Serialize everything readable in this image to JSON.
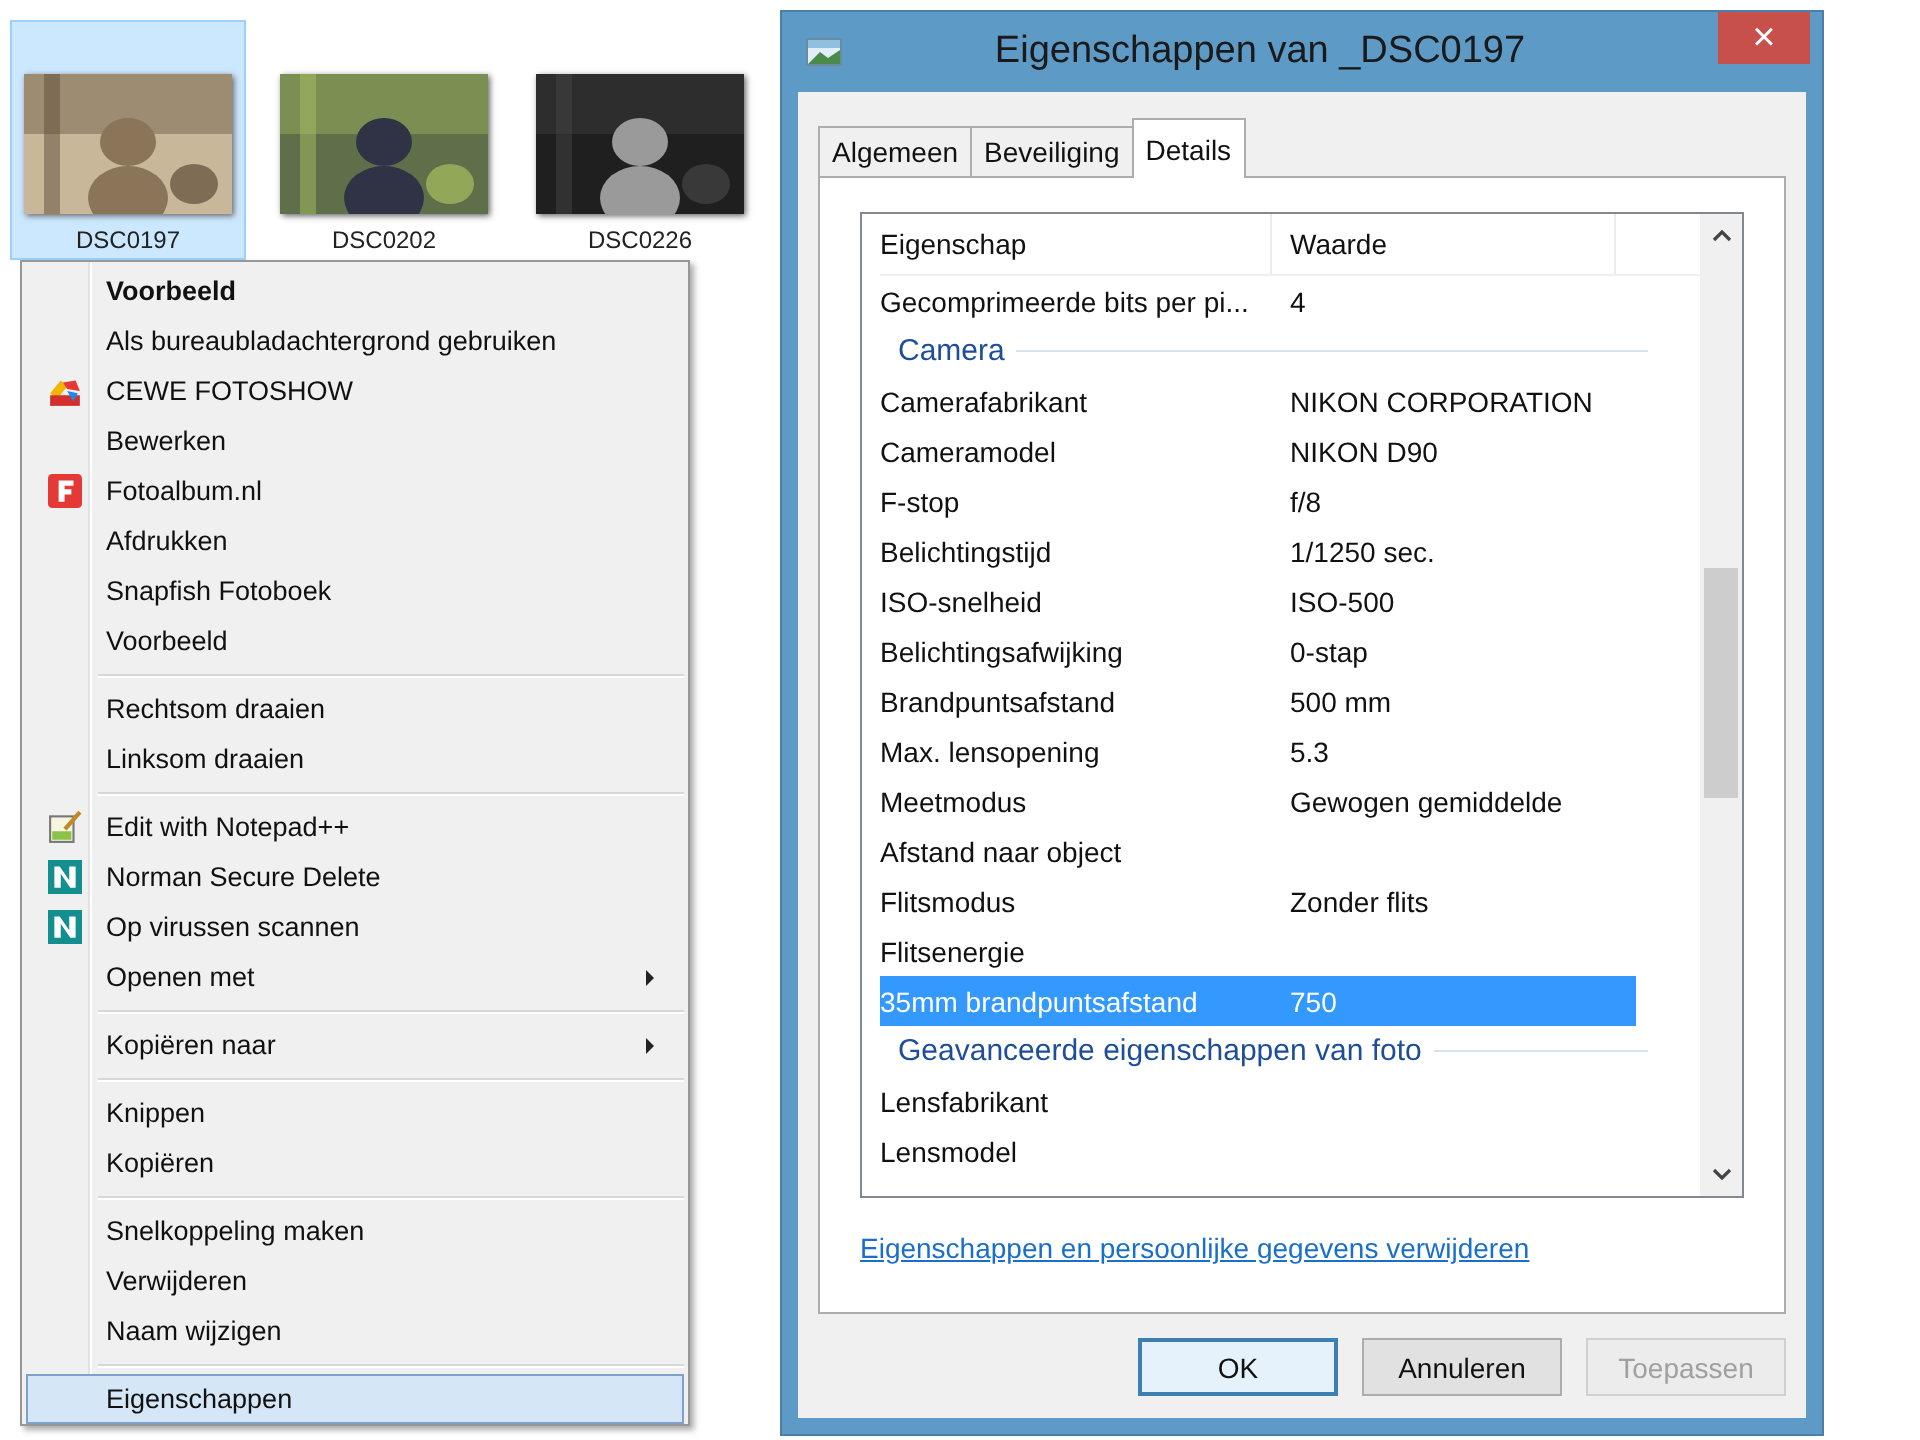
{
  "thumbnails": [
    {
      "label": "DSC0197",
      "selected": true
    },
    {
      "label": "DSC0202",
      "selected": false
    },
    {
      "label": "DSC0226",
      "selected": false
    }
  ],
  "context_menu": {
    "sections": [
      [
        {
          "label": "Voorbeeld",
          "kind": "plain",
          "default": true,
          "submenu": false,
          "selected": false
        },
        {
          "label": "Als bureaubladachtergrond gebruiken",
          "kind": "plain",
          "default": false,
          "submenu": false,
          "selected": false
        },
        {
          "label": "CEWE FOTOSHOW",
          "kind": "cewe",
          "default": false,
          "submenu": false,
          "selected": false
        },
        {
          "label": "Bewerken",
          "kind": "plain",
          "default": false,
          "submenu": false,
          "selected": false
        },
        {
          "label": "Fotoalbum.nl",
          "kind": "fotoalbum",
          "default": false,
          "submenu": false,
          "selected": false
        },
        {
          "label": "Afdrukken",
          "kind": "plain",
          "default": false,
          "submenu": false,
          "selected": false
        },
        {
          "label": "Snapfish Fotoboek",
          "kind": "plain",
          "default": false,
          "submenu": false,
          "selected": false
        },
        {
          "label": "Voorbeeld",
          "kind": "plain",
          "default": false,
          "submenu": false,
          "selected": false
        }
      ],
      [
        {
          "label": "Rechtsom draaien",
          "kind": "plain",
          "default": false,
          "submenu": false,
          "selected": false
        },
        {
          "label": "Linksom draaien",
          "kind": "plain",
          "default": false,
          "submenu": false,
          "selected": false
        }
      ],
      [
        {
          "label": "Edit with Notepad++",
          "kind": "notepad",
          "default": false,
          "submenu": false,
          "selected": false
        },
        {
          "label": "Norman Secure Delete",
          "kind": "norman",
          "default": false,
          "submenu": false,
          "selected": false
        },
        {
          "label": "Op virussen scannen",
          "kind": "norman",
          "default": false,
          "submenu": false,
          "selected": false
        },
        {
          "label": "Openen met",
          "kind": "plain",
          "default": false,
          "submenu": true,
          "selected": false
        }
      ],
      [
        {
          "label": "Kopiëren naar",
          "kind": "plain",
          "default": false,
          "submenu": true,
          "selected": false
        }
      ],
      [
        {
          "label": "Knippen",
          "kind": "plain",
          "default": false,
          "submenu": false,
          "selected": false
        },
        {
          "label": "Kopiëren",
          "kind": "plain",
          "default": false,
          "submenu": false,
          "selected": false
        }
      ],
      [
        {
          "label": "Snelkoppeling maken",
          "kind": "plain",
          "default": false,
          "submenu": false,
          "selected": false
        },
        {
          "label": "Verwijderen",
          "kind": "plain",
          "default": false,
          "submenu": false,
          "selected": false
        },
        {
          "label": "Naam wijzigen",
          "kind": "plain",
          "default": false,
          "submenu": false,
          "selected": false
        }
      ],
      [
        {
          "label": "Eigenschappen",
          "kind": "plain",
          "default": false,
          "submenu": false,
          "selected": true
        }
      ]
    ]
  },
  "dialog": {
    "title": "Eigenschappen van _DSC0197",
    "close": "×",
    "tabs": [
      {
        "label": "Algemeen",
        "selected": false
      },
      {
        "label": "Beveiliging",
        "selected": false
      },
      {
        "label": "Details",
        "selected": true
      }
    ],
    "columns": [
      "Eigenschap",
      "Waarde"
    ],
    "rows": [
      {
        "kind": "property",
        "name": "Gecomprimeerde bits per pi...",
        "value": "4",
        "selected": false
      },
      {
        "kind": "group",
        "name": "Camera"
      },
      {
        "kind": "property",
        "name": "Camerafabrikant",
        "value": "NIKON CORPORATION",
        "selected": false
      },
      {
        "kind": "property",
        "name": "Cameramodel",
        "value": "NIKON D90",
        "selected": false
      },
      {
        "kind": "property",
        "name": "F-stop",
        "value": "f/8",
        "selected": false
      },
      {
        "kind": "property",
        "name": "Belichtingstijd",
        "value": "1/1250 sec.",
        "selected": false
      },
      {
        "kind": "property",
        "name": "ISO-snelheid",
        "value": "ISO-500",
        "selected": false
      },
      {
        "kind": "property",
        "name": "Belichtingsafwijking",
        "value": "0-stap",
        "selected": false
      },
      {
        "kind": "property",
        "name": "Brandpuntsafstand",
        "value": "500 mm",
        "selected": false
      },
      {
        "kind": "property",
        "name": "Max. lensopening",
        "value": "5.3",
        "selected": false
      },
      {
        "kind": "property",
        "name": "Meetmodus",
        "value": "Gewogen gemiddelde",
        "selected": false
      },
      {
        "kind": "property",
        "name": "Afstand naar object",
        "selected": false
      },
      {
        "kind": "property",
        "name": "Flitsmodus",
        "value": "Zonder flits",
        "selected": false
      },
      {
        "kind": "property",
        "name": "Flitsenergie",
        "selected": false
      },
      {
        "kind": "property",
        "name": "35mm brandpuntsafstand",
        "value": "750",
        "selected": true
      },
      {
        "kind": "group",
        "name": "Geavanceerde eigenschappen van foto"
      },
      {
        "kind": "property",
        "name": "Lensfabrikant",
        "selected": false
      },
      {
        "kind": "property",
        "name": "Lensmodel",
        "selected": false
      }
    ],
    "link": "Eigenschappen en persoonlijke gegevens verwijderen",
    "buttons": [
      {
        "label": "OK",
        "default": true,
        "disabled": false
      },
      {
        "label": "Annuleren",
        "default": false,
        "disabled": false
      },
      {
        "label": "Toepassen",
        "default": false,
        "disabled": true
      }
    ]
  }
}
